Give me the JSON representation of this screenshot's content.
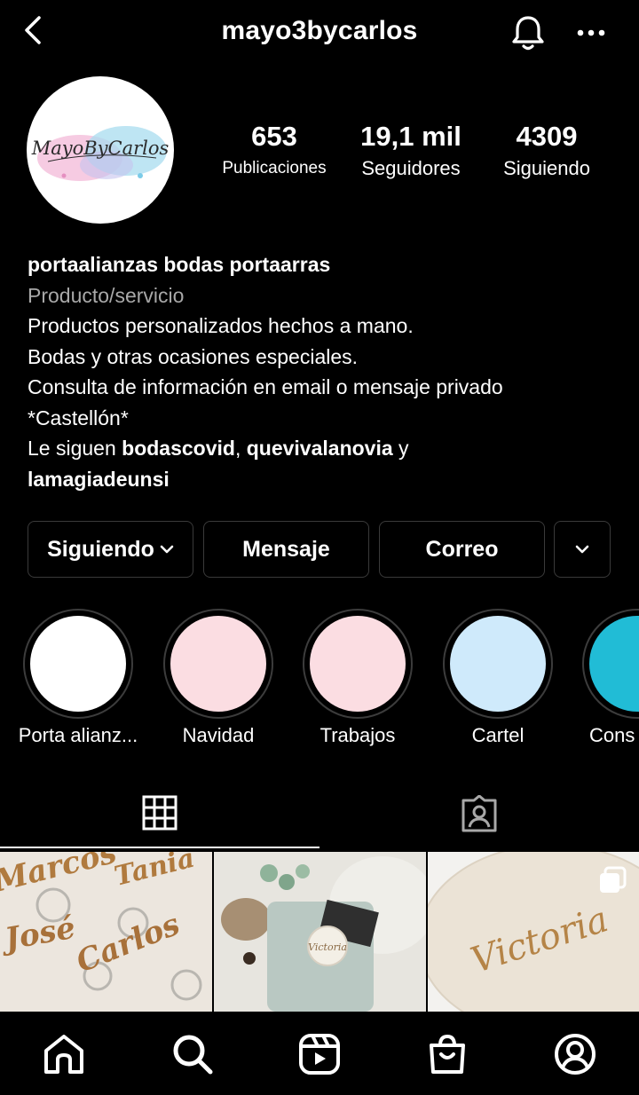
{
  "header": {
    "username": "mayo3bycarlos",
    "back_icon": "back-chevron-icon",
    "bell_icon": "bell-icon",
    "more_icon": "more-dots-icon"
  },
  "profile": {
    "avatar_text": "MayoByCarlos",
    "stats": [
      {
        "value": "653",
        "label": "Publicaciones"
      },
      {
        "value": "19,1 mil",
        "label": "Seguidores"
      },
      {
        "value": "4309",
        "label": "Siguiendo"
      }
    ],
    "name": "portaalianzas bodas portaarras",
    "category": "Producto/servicio",
    "bio_lines": [
      "Productos personalizados hechos a mano.",
      "Bodas y otras ocasiones especiales.",
      "Consulta de información en email o mensaje privado",
      "*Castellón*"
    ],
    "followed_by": {
      "prefix": "Le siguen ",
      "user1": "bodascovid",
      "sep1": ", ",
      "user2": "quevivalanovia",
      "sep2": " y",
      "user3": "lamagiadeunsi"
    }
  },
  "actions": {
    "following": "Siguiendo",
    "message": "Mensaje",
    "email": "Correo"
  },
  "highlights": [
    {
      "label": "Porta alianz...",
      "color": "#ffffff"
    },
    {
      "label": "Navidad",
      "color": "#fbdde2"
    },
    {
      "label": "Trabajos",
      "color": "#fbdde2"
    },
    {
      "label": "Cartel",
      "color": "#cfeafb"
    },
    {
      "label": "Cons",
      "color": "#21bcd6"
    }
  ],
  "tabs": {
    "grid_icon": "grid-icon",
    "tagged_icon": "tagged-person-icon"
  },
  "posts": {
    "post1_words": [
      "Marcos",
      "Tania",
      "José",
      "Carlos"
    ],
    "post2_word": "Victoria",
    "post3_word": "Victoria",
    "multi_icon": "multiple-posts-icon"
  },
  "bottom_nav": [
    "home-icon",
    "search-icon",
    "reels-icon",
    "shop-icon",
    "profile-icon"
  ],
  "colors": {
    "background": "#000000",
    "secondary_text": "#a8a8a8",
    "button_border": "#3a3a3a"
  }
}
